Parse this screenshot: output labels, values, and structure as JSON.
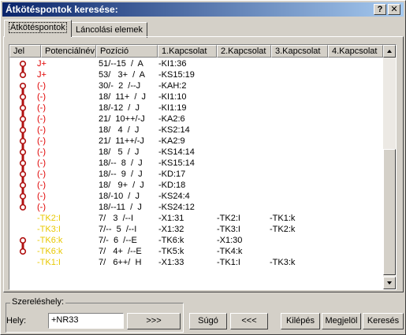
{
  "window": {
    "title": "Átkötéspontok keresése:",
    "help_label": "?",
    "close_label": "✕"
  },
  "tabs": [
    {
      "label": "Átkötéspontok",
      "active": true
    },
    {
      "label": "Láncolási elemek",
      "active": false
    }
  ],
  "table": {
    "columns": [
      "Jel",
      "Potenciálnév",
      "Pozíció",
      "1.Kapcsolat",
      "2.Kapcsolat",
      "3.Kapcsolat",
      "4.Kapcsolat"
    ],
    "rows": [
      {
        "marker": "top",
        "potential": "J+",
        "position": "51/--15  /  A",
        "k1": "-KI1:36",
        "k2": "",
        "k3": "",
        "k4": "",
        "color": "#e00000"
      },
      {
        "marker": "bottom",
        "potential": "J+",
        "position": "53/   3+  /  A",
        "k1": "-KS15:19",
        "k2": "",
        "k3": "",
        "k4": "",
        "color": "#e00000"
      },
      {
        "marker": "top",
        "potential": "(-)",
        "position": "30/-  2  /--J",
        "k1": "-KAH:2",
        "k2": "",
        "k3": "",
        "k4": "",
        "color": "#e00000"
      },
      {
        "marker": "mid",
        "potential": "(-)",
        "position": "18/  11+  /  J",
        "k1": "-KI1:10",
        "k2": "",
        "k3": "",
        "k4": "",
        "color": "#e00000"
      },
      {
        "marker": "mid",
        "potential": "(-)",
        "position": "18/-12  /  J",
        "k1": "-KI1:19",
        "k2": "",
        "k3": "",
        "k4": "",
        "color": "#e00000"
      },
      {
        "marker": "mid",
        "potential": "(-)",
        "position": "21/  10++/-J",
        "k1": "-KA2:6",
        "k2": "",
        "k3": "",
        "k4": "",
        "color": "#e00000"
      },
      {
        "marker": "mid",
        "potential": "(-)",
        "position": "18/   4  /  J",
        "k1": "-KS2:14",
        "k2": "",
        "k3": "",
        "k4": "",
        "color": "#e00000"
      },
      {
        "marker": "mid",
        "potential": "(-)",
        "position": "21/  11++/-J",
        "k1": "-KA2:9",
        "k2": "",
        "k3": "",
        "k4": "",
        "color": "#e00000"
      },
      {
        "marker": "mid",
        "potential": "(-)",
        "position": "18/   5  /  J",
        "k1": "-KS14:14",
        "k2": "",
        "k3": "",
        "k4": "",
        "color": "#e00000"
      },
      {
        "marker": "mid",
        "potential": "(-)",
        "position": "18/--  8  /  J",
        "k1": "-KS15:14",
        "k2": "",
        "k3": "",
        "k4": "",
        "color": "#e00000"
      },
      {
        "marker": "mid",
        "potential": "(-)",
        "position": "18/--  9  /  J",
        "k1": "-KD:17",
        "k2": "",
        "k3": "",
        "k4": "",
        "color": "#e00000"
      },
      {
        "marker": "mid",
        "potential": "(-)",
        "position": "18/   9+  /  J",
        "k1": "-KD:18",
        "k2": "",
        "k3": "",
        "k4": "",
        "color": "#e00000"
      },
      {
        "marker": "mid",
        "potential": "(-)",
        "position": "18/-10  /  J",
        "k1": "-KS24:4",
        "k2": "",
        "k3": "",
        "k4": "",
        "color": "#e00000"
      },
      {
        "marker": "bottom",
        "potential": "(-)",
        "position": "18/--11  /  J",
        "k1": "-KS24:12",
        "k2": "",
        "k3": "",
        "k4": "",
        "color": "#e00000"
      },
      {
        "marker": "",
        "potential": "-TK2:I",
        "position": "7/   3  /--I",
        "k1": "-X1:31",
        "k2": "-TK2:I",
        "k3": "-TK1:k",
        "k4": "",
        "color": "#e8c800"
      },
      {
        "marker": "",
        "potential": "-TK3:I",
        "position": "7/--  5  /--I",
        "k1": "-X1:32",
        "k2": "-TK3:I",
        "k3": "-TK2:k",
        "k4": "",
        "color": "#e8c800"
      },
      {
        "marker": "top",
        "potential": "-TK6:k",
        "position": "7/-  6  /--E",
        "k1": "-TK6:k",
        "k2": "-X1:30",
        "k3": "",
        "k4": "",
        "color": "#e8c800"
      },
      {
        "marker": "bottom",
        "potential": "-TK6:k",
        "position": "7/   4+  /--E",
        "k1": "-TK5:k",
        "k2": "-TK4:k",
        "k3": "",
        "k4": "",
        "color": "#e8c800"
      },
      {
        "marker": "",
        "potential": "-TK1:I",
        "position": "7/   6++/  H",
        "k1": "-X1:33",
        "k2": "-TK1:I",
        "k3": "-TK3:k",
        "k4": "",
        "color": "#e8c800"
      }
    ]
  },
  "location": {
    "group_label": "Szereléshely:",
    "field_label": "Hely:",
    "field_value": "+NR33",
    "forward_label": ">>>"
  },
  "buttons": {
    "help": "Súgó",
    "back": "<<<",
    "exit": "Kilépés",
    "mark": "Megjelöl",
    "search": "Keresés"
  },
  "colors": {
    "marker": "#b01010",
    "red_text": "#e00000",
    "yellow_text": "#e8c800"
  }
}
